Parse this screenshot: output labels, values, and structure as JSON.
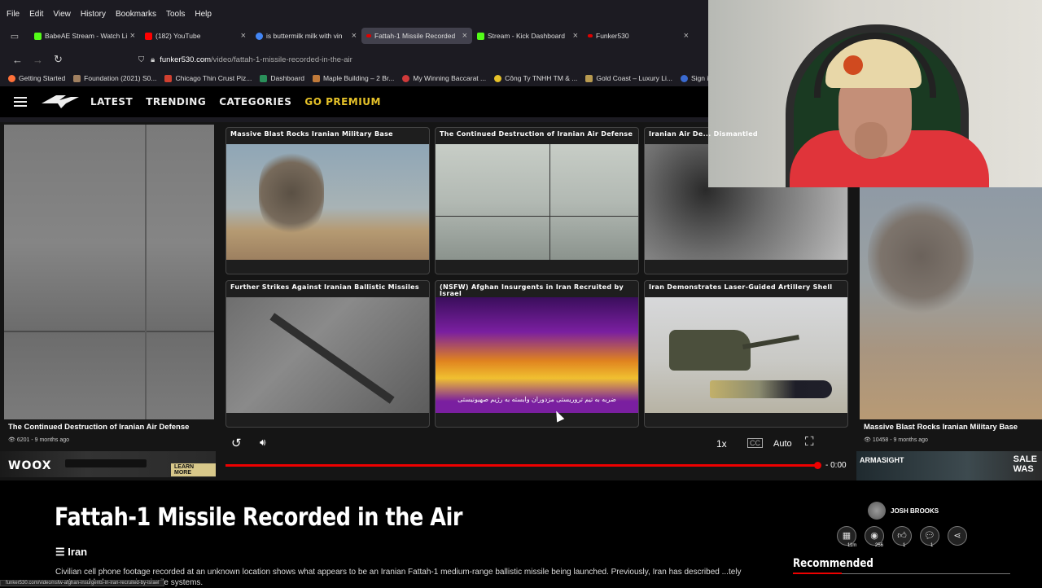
{
  "browser": {
    "menu": [
      "File",
      "Edit",
      "View",
      "History",
      "Bookmarks",
      "Tools",
      "Help"
    ],
    "tabs": [
      {
        "title": "BabeAE Stream - Watch Li",
        "color": "#53fc18",
        "active": false
      },
      {
        "title": "(182) YouTube",
        "color": "#ff0000",
        "active": false
      },
      {
        "title": "is buttermilk milk with vin",
        "color": "#4285f4",
        "active": false
      },
      {
        "title": "Fattah-1 Missile Recorded",
        "color": "#e00000",
        "active": true
      },
      {
        "title": "Stream - Kick Dashboard",
        "color": "#53fc18",
        "active": false
      },
      {
        "title": "Funker530",
        "color": "#e00000",
        "active": false
      }
    ],
    "url_domain": "funker530.com",
    "url_path": "/video/fattah-1-missile-recorded-in-the-air",
    "bookmarks": [
      {
        "label": "Getting Started",
        "color": "#ff7139"
      },
      {
        "label": "Foundation (2021) S0...",
        "color": "#a08060"
      },
      {
        "label": "Chicago Thin Crust Piz...",
        "color": "#d04030"
      },
      {
        "label": "Dashboard",
        "color": "#2a8f5a"
      },
      {
        "label": "Maple Building – 2 Br...",
        "color": "#c07a3a"
      },
      {
        "label": "My Winning Baccarat ...",
        "color": "#d03a3a"
      },
      {
        "label": "Công Ty TNHH TM & ...",
        "color": "#e6c229"
      },
      {
        "label": "Gold Coast – Luxury Li...",
        "color": "#b89a50"
      },
      {
        "label": "Sign in - Dre",
        "color": "#3a6ad0"
      }
    ]
  },
  "site": {
    "nav": [
      "LATEST",
      "TRENDING",
      "CATEGORIES",
      "GO PREMIUM"
    ]
  },
  "player": {
    "left_title": "The Continued Destruction of Iranian Air Defense",
    "left_meta": "6201 - 9 months ago",
    "right_title": "Massive Blast Rocks Iranian Military Base",
    "right_meta": "10458 - 9 months ago",
    "cards": [
      "Massive Blast Rocks Iranian Military Base",
      "The Continued Destruction of Iranian Air Defense",
      "Iranian Air De... Dismantled",
      "Further Strikes Against Iranian Ballistic Missiles",
      "(NSFW) Afghan Insurgents in Iran Recruited by Israel",
      "Iran Demonstrates Laser-Guided Artillery Shell"
    ],
    "card5_subtitle": "ضربه به تیم تروریستی مزدوران وابسته به رژیم صهیونیستی",
    "speed": "1x",
    "quality": "Auto",
    "time": "- 0:00",
    "progress": 0.99,
    "ad_left_brand": "WOOX",
    "ad_left_cta": "LEARN MORE",
    "ad_right_brand": "ARMASIGHT",
    "ad_right_sale_1": "SALE",
    "ad_right_sale_2": "WAS"
  },
  "video": {
    "title": "Fattah-1 Missile Recorded in the Air",
    "category": "Iran",
    "description": "Civilian cell phone footage recorded at an unknown location shows what appears to be an Iranian Fattah-1 medium-range ballistic missile being launched. Previously, Iran has described ...tely unstoppable hypersonic missile systems.",
    "author": "JOSH BROOKS",
    "stats": [
      {
        "icon": "calendar-icon",
        "value": "11m"
      },
      {
        "icon": "eye-icon",
        "value": "256"
      },
      {
        "icon": "thumbs-up-icon",
        "value": "1"
      },
      {
        "icon": "comment-icon",
        "value": "1"
      },
      {
        "icon": "share-icon",
        "value": ""
      }
    ],
    "recommended": "Recommended"
  },
  "status_url": "funker530.com/video/nsfw-afghan-insurgents-in-iran-recruited-by-israel"
}
